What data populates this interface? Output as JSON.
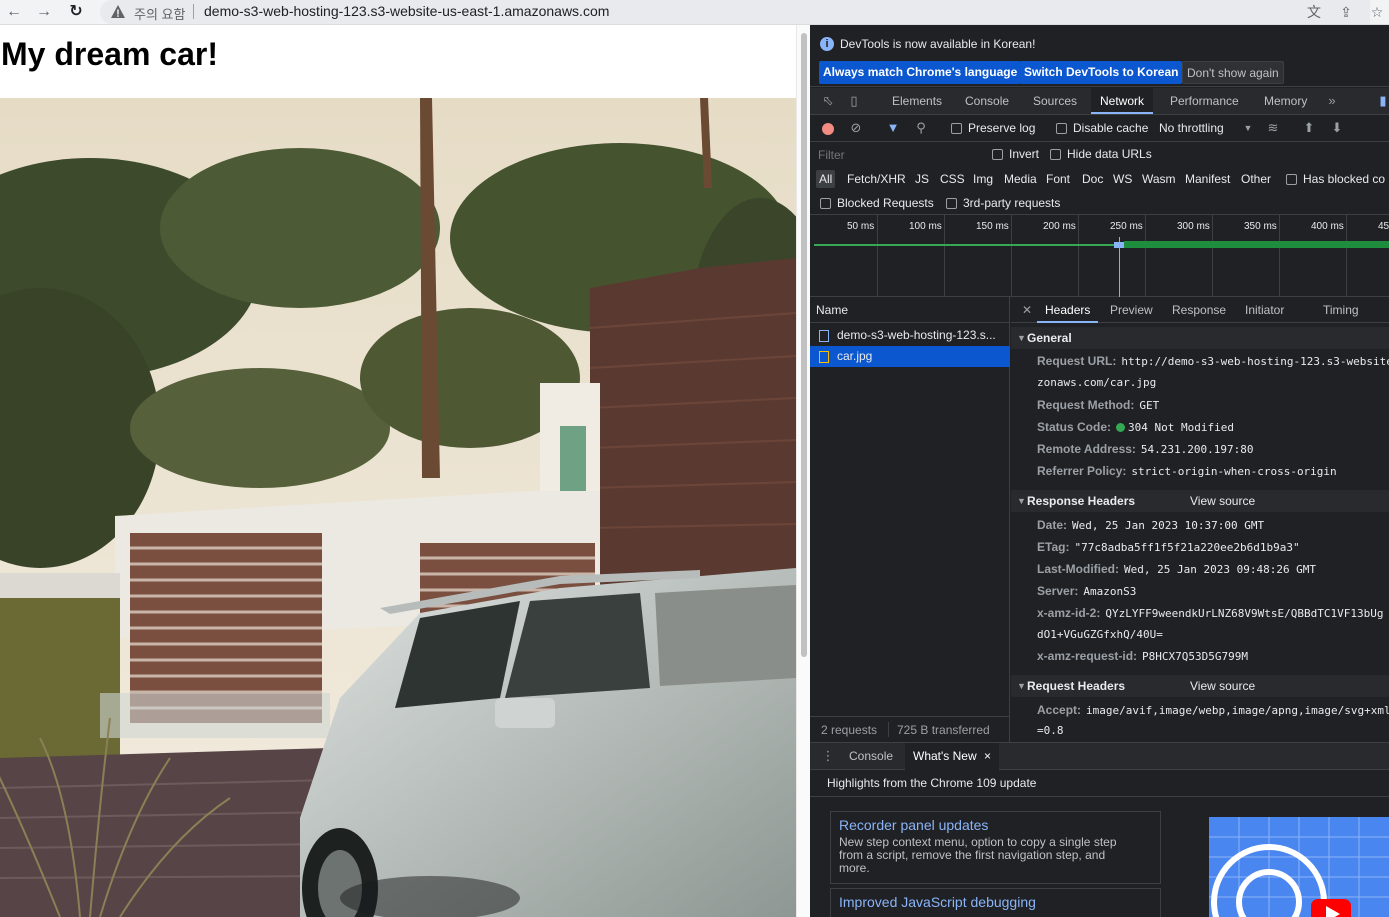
{
  "browser": {
    "security_label": "주의 요함",
    "url": "demo-s3-web-hosting-123.s3-website-us-east-1.amazonaws.com"
  },
  "page": {
    "heading": "My dream car!"
  },
  "devtools": {
    "banner": {
      "message": "DevTools is now available in Korean!",
      "match_language_label": "Always match Chrome's language",
      "switch_korean_label": "Switch DevTools to Korean",
      "dont_show_label": "Don't show again"
    },
    "tabs": [
      "Elements",
      "Console",
      "Sources",
      "Network",
      "Performance",
      "Memory"
    ],
    "active_tab": "Network",
    "network": {
      "toolbar": {
        "preserve_log": "Preserve log",
        "disable_cache": "Disable cache",
        "throttling": "No throttling"
      },
      "filter": {
        "placeholder": "Filter",
        "invert": "Invert",
        "hide_data_urls": "Hide data URLs"
      },
      "types": [
        "All",
        "Fetch/XHR",
        "JS",
        "CSS",
        "Img",
        "Media",
        "Font",
        "Doc",
        "WS",
        "Wasm",
        "Manifest",
        "Other"
      ],
      "has_blocked_cookies": "Has blocked co",
      "blocked_requests": "Blocked Requests",
      "third_party": "3rd-party requests",
      "timeline_ticks": [
        "50 ms",
        "100 ms",
        "150 ms",
        "200 ms",
        "250 ms",
        "300 ms",
        "350 ms",
        "400 ms",
        "45"
      ],
      "name_header": "Name",
      "requests": [
        {
          "name": "demo-s3-web-hosting-123.s...",
          "selected": false
        },
        {
          "name": "car.jpg",
          "selected": true
        }
      ],
      "summary": {
        "requests": "2 requests",
        "transferred": "725 B transferred"
      },
      "detail_tabs": [
        "Headers",
        "Preview",
        "Response",
        "Initiator",
        "Timing"
      ],
      "active_detail_tab": "Headers",
      "view_source": "View source",
      "general": {
        "title": "General",
        "request_url_key": "Request URL:",
        "request_url_val": "http://demo-s3-web-hosting-123.s3-website",
        "request_url_cont": "zonaws.com/car.jpg",
        "method_key": "Request Method:",
        "method_val": "GET",
        "status_key": "Status Code:",
        "status_val": "304 Not Modified",
        "remote_key": "Remote Address:",
        "remote_val": "54.231.200.197:80",
        "referrer_key": "Referrer Policy:",
        "referrer_val": "strict-origin-when-cross-origin"
      },
      "response_headers": {
        "title": "Response Headers",
        "date_key": "Date:",
        "date_val": "Wed, 25 Jan 2023 10:37:00 GMT",
        "etag_key": "ETag:",
        "etag_val": "\"77c8adba5ff1f5f21a220ee2b6d1b9a3\"",
        "lastmod_key": "Last-Modified:",
        "lastmod_val": "Wed, 25 Jan 2023 09:48:26 GMT",
        "server_key": "Server:",
        "server_val": "AmazonS3",
        "amzid2_key": "x-amz-id-2:",
        "amzid2_val": "QYzLYFF9weendkUrLNZ68V9WtsE/QBBdTC1VF13bUg",
        "amzid2_cont": "dO1+VGuGZGfxhQ/40U=",
        "reqid_key": "x-amz-request-id:",
        "reqid_val": "P8HCX7Q53D5G799M"
      },
      "request_headers": {
        "title": "Request Headers",
        "accept_key": "Accept:",
        "accept_val": "image/avif,image/webp,image/apng,image/svg+xml",
        "accept_cont": "=0.8"
      }
    },
    "drawer": {
      "tabs": [
        "Console",
        "What's New"
      ],
      "active_tab": "What's New",
      "highlights": "Highlights from the Chrome 109 update",
      "cards": [
        {
          "title": "Recorder panel updates",
          "description_lines": [
            "New step context menu, option to copy a single step",
            "from a script, remove the first navigation step, and",
            "more."
          ]
        },
        {
          "title": "Improved JavaScript debugging",
          "description_lines": []
        }
      ]
    }
  }
}
